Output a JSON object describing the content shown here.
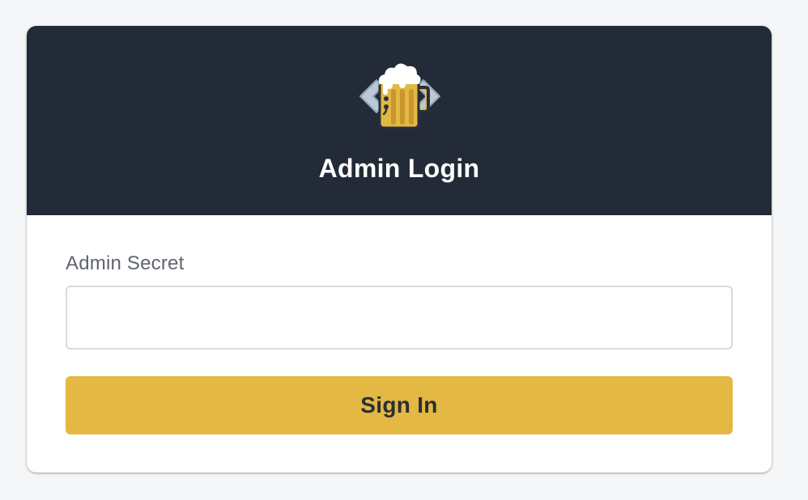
{
  "header": {
    "logo_icon": "beer-mug-code-icon",
    "title": "Admin Login"
  },
  "form": {
    "secret_label": "Admin Secret",
    "secret_value": "",
    "secret_placeholder": "",
    "submit_label": "Sign In"
  },
  "colors": {
    "page_background": "#f5f6f8",
    "header_background": "#222b37",
    "accent": "#e3b843",
    "label_text": "#5e6470"
  }
}
